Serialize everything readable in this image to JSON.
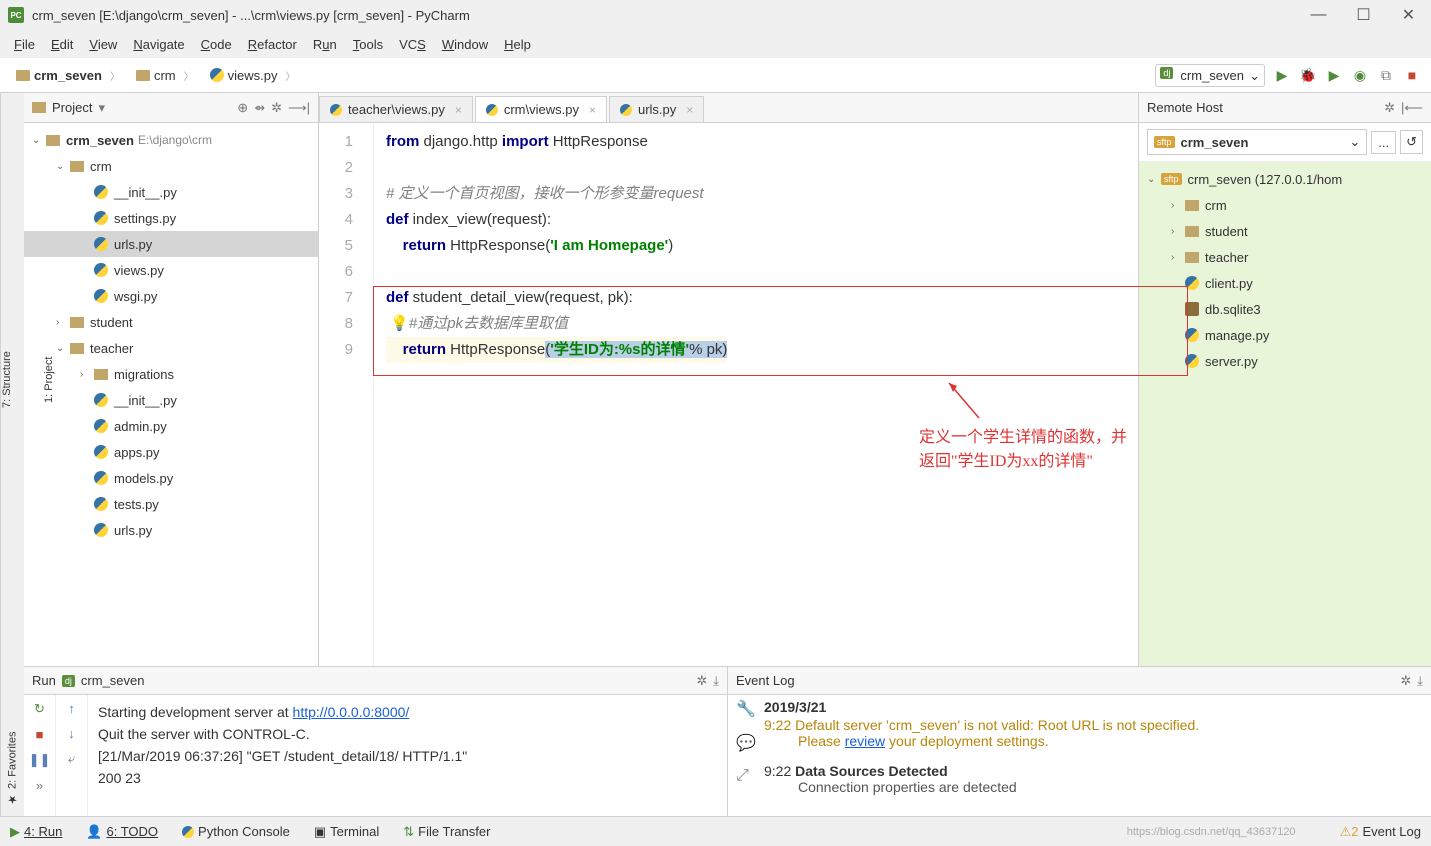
{
  "window_title": "crm_seven [E:\\django\\crm_seven] - ...\\crm\\views.py [crm_seven] - PyCharm",
  "menu": {
    "file": "File",
    "edit": "Edit",
    "view": "View",
    "navigate": "Navigate",
    "code": "Code",
    "refactor": "Refactor",
    "run": "Run",
    "tools": "Tools",
    "vcs": "VCS",
    "window": "Window",
    "help": "Help"
  },
  "breadcrumbs": {
    "root": "crm_seven",
    "folder": "crm",
    "file": "views.py"
  },
  "run_config": "crm_seven",
  "project_panel": {
    "title": "Project",
    "tree": [
      {
        "type": "root",
        "name": "crm_seven",
        "path": "E:\\django\\crm",
        "depth": 0,
        "expanded": true,
        "arrow": "⌄"
      },
      {
        "type": "dir",
        "name": "crm",
        "depth": 1,
        "expanded": true,
        "arrow": "⌄"
      },
      {
        "type": "py",
        "name": "__init__.py",
        "depth": 2
      },
      {
        "type": "py",
        "name": "settings.py",
        "depth": 2
      },
      {
        "type": "py",
        "name": "urls.py",
        "depth": 2,
        "selected": true
      },
      {
        "type": "py",
        "name": "views.py",
        "depth": 2
      },
      {
        "type": "py",
        "name": "wsgi.py",
        "depth": 2
      },
      {
        "type": "dir",
        "name": "student",
        "depth": 1,
        "arrow": "›"
      },
      {
        "type": "dir",
        "name": "teacher",
        "depth": 1,
        "expanded": true,
        "arrow": "⌄"
      },
      {
        "type": "dir",
        "name": "migrations",
        "depth": 2,
        "arrow": "›"
      },
      {
        "type": "py",
        "name": "__init__.py",
        "depth": 2
      },
      {
        "type": "py",
        "name": "admin.py",
        "depth": 2
      },
      {
        "type": "py",
        "name": "apps.py",
        "depth": 2
      },
      {
        "type": "py",
        "name": "models.py",
        "depth": 2
      },
      {
        "type": "py",
        "name": "tests.py",
        "depth": 2
      },
      {
        "type": "py",
        "name": "urls.py",
        "depth": 2
      }
    ]
  },
  "editor_tabs": [
    {
      "label": "teacher\\views.py",
      "active": false
    },
    {
      "label": "crm\\views.py",
      "active": true
    },
    {
      "label": "urls.py",
      "active": false
    }
  ],
  "code": {
    "lines": [
      "1",
      "2",
      "3",
      "4",
      "5",
      "6",
      "7",
      "8",
      "9"
    ],
    "l1_pre": "from",
    "l1_mid": " django.http ",
    "l1_imp": "import",
    "l1_post": " HttpResponse",
    "l3": "# 定义一个首页视图，接收一个形参变量request",
    "l4_def": "def",
    "l4_rest": " index_view(request):",
    "l5_ret": "return",
    "l5_call": " HttpResponse(",
    "l5_str": "'I am Homepage'",
    "l5_close": ")",
    "l7_def": "def",
    "l7_rest": " student_detail_view(request, pk):",
    "l8": "#通过pk去数据库里取值",
    "l9_ret": "return",
    "l9_call": " HttpResponse",
    "l9_paren": "(",
    "l9_str": "'学生ID为:%s的详情'",
    "l9_pk": "% pk",
    "l9_close": ")"
  },
  "annotation": "定义一个学生详情的函数，并返回\"学生ID为xx的详情\"",
  "remote_panel": {
    "title": "Remote Host",
    "selected": "crm_seven",
    "root": "crm_seven (127.0.0.1/hom",
    "items": [
      {
        "type": "dir",
        "name": "crm",
        "depth": 1
      },
      {
        "type": "dir",
        "name": "student",
        "depth": 1
      },
      {
        "type": "dir",
        "name": "teacher",
        "depth": 1
      },
      {
        "type": "py",
        "name": "client.py",
        "depth": 1
      },
      {
        "type": "file",
        "name": "db.sqlite3",
        "depth": 1
      },
      {
        "type": "py",
        "name": "manage.py",
        "depth": 1
      },
      {
        "type": "py",
        "name": "server.py",
        "depth": 1
      }
    ]
  },
  "run_panel": {
    "title": "Run",
    "config": "crm_seven",
    "line1_pre": "Starting development server at ",
    "line1_url": "http://0.0.0.0:8000/",
    "line2": "Quit the server with CONTROL-C.",
    "line3": "[21/Mar/2019 06:37:26] \"GET /student_detail/18/ HTTP/1.1\"",
    "line4": " 200 23"
  },
  "event_panel": {
    "title": "Event Log",
    "date": "2019/3/21",
    "t1": "9:22",
    "msg1a": "Default server 'crm_seven' is not valid: Root URL is not specified.",
    "msg1b_pre": "Please ",
    "msg1b_link": "review",
    "msg1b_post": " your deployment settings.",
    "t2": "9:22",
    "msg2_title": "Data Sources Detected",
    "msg2_body": "Connection properties are detected"
  },
  "status_bar": {
    "run": "4: Run",
    "todo": "6: TODO",
    "python_console": "Python Console",
    "terminal": "Terminal",
    "file_transfer": "File Transfer",
    "event_log": "Event Log"
  },
  "strips": {
    "project": "1: Project",
    "structure": "7: Structure",
    "favorites": "2: Favorites"
  },
  "watermark": "https://blog.csdn.net/qq_43637120"
}
